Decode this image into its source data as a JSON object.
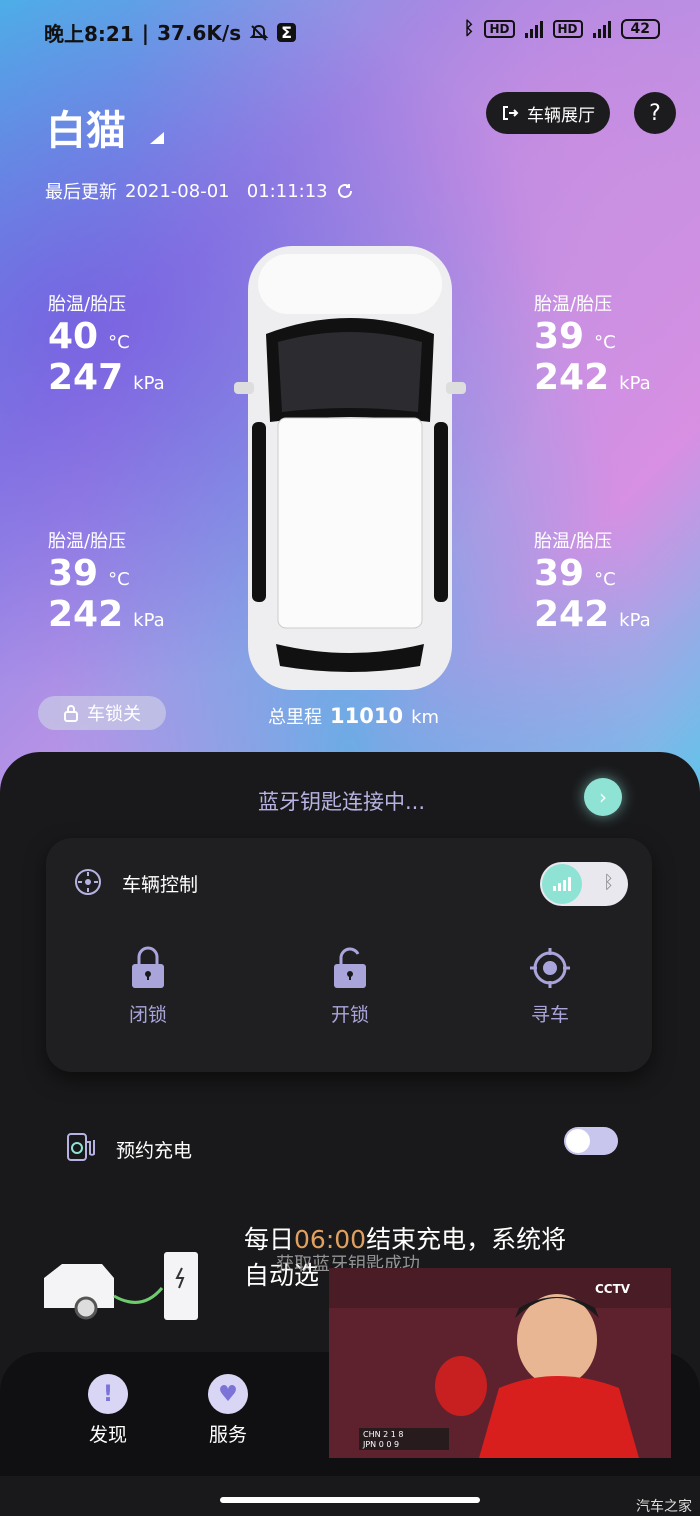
{
  "status_bar": {
    "time": "晚上8:21",
    "speed": "37.6K/s",
    "battery": "42",
    "hd": "HD",
    "net": "4G"
  },
  "header": {
    "vehicle_name": "白猫",
    "showroom_label": "车辆展厅",
    "help_label": "?"
  },
  "last_update": {
    "label": "最后更新",
    "value": "2021-08-01   01:11:13"
  },
  "tires": {
    "front_left": {
      "label": "胎温/胎压",
      "temp": "40",
      "temp_unit": "°C",
      "pressure": "247",
      "pressure_unit": "kPa"
    },
    "front_right": {
      "label": "胎温/胎压",
      "temp": "39",
      "temp_unit": "°C",
      "pressure": "242",
      "pressure_unit": "kPa"
    },
    "rear_left": {
      "label": "胎温/胎压",
      "temp": "39",
      "temp_unit": "°C",
      "pressure": "242",
      "pressure_unit": "kPa"
    },
    "rear_right": {
      "label": "胎温/胎压",
      "temp": "39",
      "temp_unit": "°C",
      "pressure": "242",
      "pressure_unit": "kPa"
    }
  },
  "lock_status": "车锁关",
  "mileage": {
    "label": "总里程",
    "value": "11010",
    "unit": "km"
  },
  "bluetooth": {
    "status": "蓝牙钥匙连接中..."
  },
  "vehicle_control": {
    "title": "车辆控制",
    "actions": [
      {
        "label": "闭锁"
      },
      {
        "label": "开锁"
      },
      {
        "label": "寻车"
      }
    ]
  },
  "charging": {
    "title": "预约充电",
    "desc_prefix": "每日",
    "time": "06:00",
    "desc_suffix": "结束充电，系统将",
    "desc_line2": "自动选",
    "enabled": false
  },
  "toast": "获取蓝牙钥匙成功",
  "nav": [
    {
      "label": "发现",
      "icon": "exclamation-icon"
    },
    {
      "label": "服务",
      "icon": "heart-icon"
    }
  ],
  "video": {
    "channel": "CCTV",
    "score_row1": "CHN 2 1 8",
    "score_row2": "JPN 0 0 9"
  },
  "watermark": "汽车之家"
}
